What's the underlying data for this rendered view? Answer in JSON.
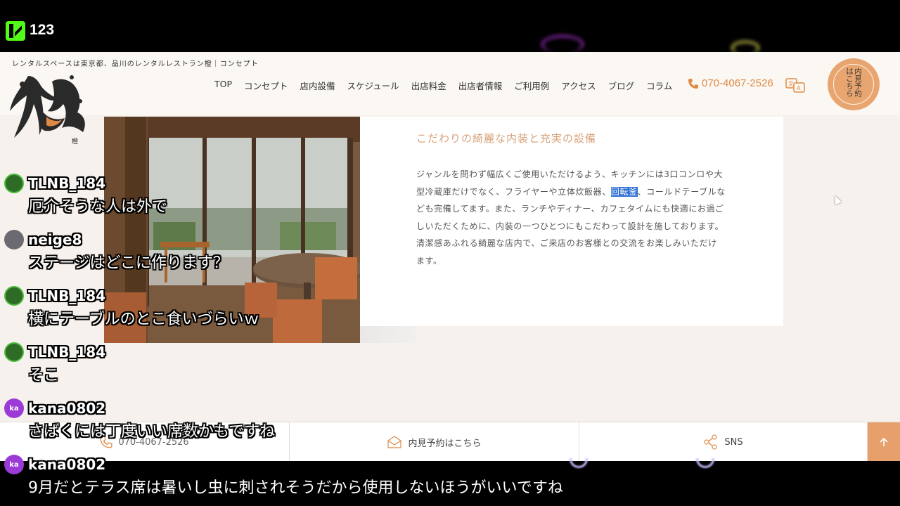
{
  "stream": {
    "viewer_count": "123"
  },
  "site": {
    "tagline": "レンタルスペースは東京都、品川のレンタルレストラン橙｜コンセプト",
    "nav": [
      "TOP",
      "コンセプト",
      "店内設備",
      "スケジュール",
      "出店料金",
      "出店者情報",
      "ご利用例",
      "アクセス",
      "ブログ",
      "コラム"
    ],
    "phone": "070-4067-2526",
    "reserve_button": "内見予約はこちら",
    "content": {
      "title": "こだわりの綺麗な内装と充実の設備",
      "body_before": "ジャンルを問わず幅広くご使用いただけるよう、キッチンには3口コンロや大型冷蔵庫だけでなく、フライヤーや立体炊飯器、",
      "body_highlight": "回転釜",
      "body_after": "、コールドテーブルなども完備してます。また、ランチやディナー、カフェタイムにも快適にお過ごしいただくために、内装の一つひとつにもこだわって設計を施しております。清潔感あふれる綺麗な店内で、ご来店のお客様との交流をお楽しみいただけます。"
    },
    "footer": {
      "phone": "070-4067-2526",
      "reserve": "内見予約はこちら",
      "sns": "SNS"
    },
    "accent_color": "#e08a45"
  },
  "chat": [
    {
      "user": "TLNB_184",
      "avatar": "green",
      "text": "厄介そうな人は外で"
    },
    {
      "user": "neige8",
      "avatar": "photo",
      "text": "ステージはどこに作ります？"
    },
    {
      "user": "TLNB_184",
      "avatar": "green",
      "text": "横にテーブルのとこ食いづらいｗ"
    },
    {
      "user": "TLNB_184",
      "avatar": "green",
      "text": "そこ"
    },
    {
      "user": "kana0802",
      "avatar": "ka",
      "text": "さばくには丁度いい席数かもですね"
    },
    {
      "user": "kana0802",
      "avatar": "ka",
      "text": "9月だとテラス席は暑いし虫に刺されそうだから使用しないほうがいいですね"
    }
  ]
}
